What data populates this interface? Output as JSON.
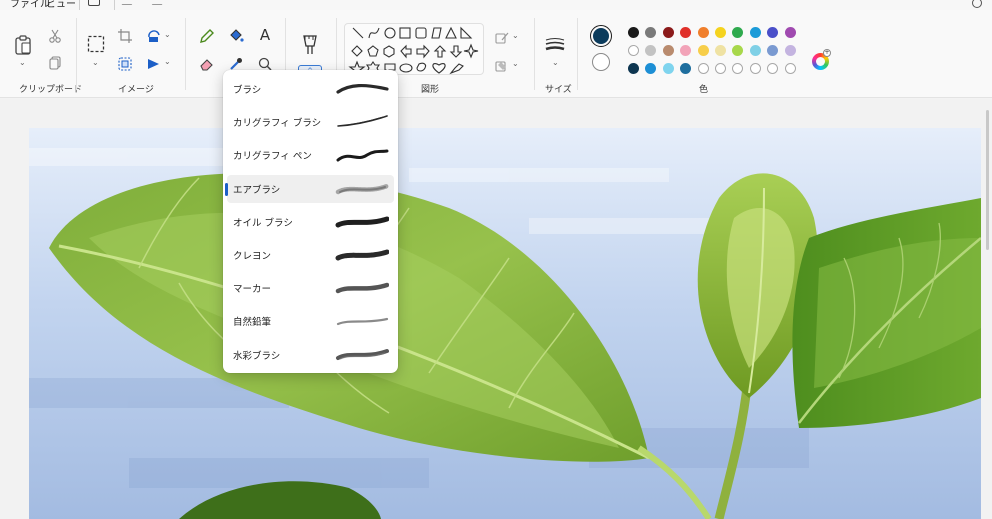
{
  "menubar": {
    "file": "ファイル",
    "view": "ビュー"
  },
  "ribbon": {
    "groups": {
      "clipboard": "クリップボード",
      "image": "イメージ",
      "shapes": "図形",
      "size": "サイズ",
      "colors": "色"
    },
    "text_tool_glyph": "A",
    "active_color": "#0b3b5c",
    "secondary_color": "#ffffff",
    "palette": [
      [
        "#1a1a1a",
        "#7a7a7a",
        "#8b1a1a",
        "#e0302a",
        "#f07f2c",
        "#f5d31e",
        "#2faa4e",
        "#1b9bd8",
        "#4a4fc9",
        "#a04ab0"
      ],
      [
        "#ffffff",
        "#c3c3c3",
        "#b98b6e",
        "#f2a3b8",
        "#f7ce4a",
        "#efe2a3",
        "#a8d84b",
        "#7fd0e6",
        "#7a9ad1",
        "#c4b4e0"
      ],
      [
        "#0d3550",
        "#1d8fd5",
        "#7fd4ee",
        "#1e6e9e",
        "",
        "",
        "",
        "",
        "",
        ""
      ]
    ]
  },
  "brushes_menu": {
    "items": [
      {
        "label": "ブラシ",
        "stroke": "brush"
      },
      {
        "label": "カリグラフィ ブラシ",
        "stroke": "calligraphy-brush"
      },
      {
        "label": "カリグラフィ ペン",
        "stroke": "calligraphy-pen"
      },
      {
        "label": "エアブラシ",
        "stroke": "airbrush",
        "selected": true
      },
      {
        "label": "オイル ブラシ",
        "stroke": "oil-brush"
      },
      {
        "label": "クレヨン",
        "stroke": "crayon"
      },
      {
        "label": "マーカー",
        "stroke": "marker"
      },
      {
        "label": "自然鉛筆",
        "stroke": "natural-pencil"
      },
      {
        "label": "水彩ブラシ",
        "stroke": "watercolor-brush"
      }
    ]
  }
}
